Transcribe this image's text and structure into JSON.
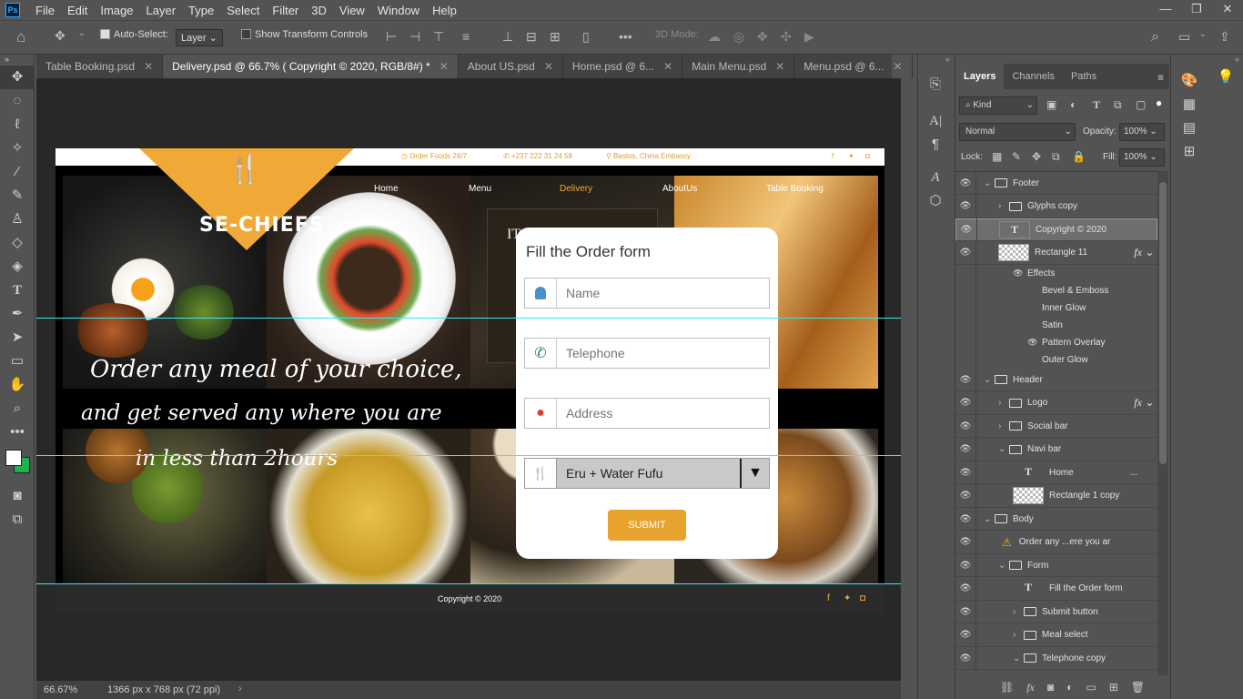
{
  "menu": [
    "File",
    "Edit",
    "Image",
    "Layer",
    "Type",
    "Select",
    "Filter",
    "3D",
    "View",
    "Window",
    "Help"
  ],
  "options": {
    "auto_select": "Auto-Select:",
    "auto_select_target": "Layer",
    "transform_controls": "Show Transform Controls",
    "mode_3d": "3D Mode:"
  },
  "tabs": [
    {
      "label": "Table Booking.psd",
      "active": false
    },
    {
      "label": "Delivery.psd @ 66.7% ( Copyright © 2020, RGB/8#) *",
      "active": true
    },
    {
      "label": "About US.psd",
      "active": false
    },
    {
      "label": "Home.psd @ 6...",
      "active": false
    },
    {
      "label": "Main Menu.psd",
      "active": false
    },
    {
      "label": "Menu.psd @ 6...",
      "active": false
    }
  ],
  "status": {
    "zoom": "66.67%",
    "doc_size": "1366 px x 768 px (72 ppi)"
  },
  "site": {
    "topbar": {
      "order": "Order Foods 24/7",
      "phone": "+237 222 31 24 58",
      "location": "Bastos, China Embassy"
    },
    "logo": "SE-CHIEFS",
    "nav": [
      "Home",
      "Menu",
      "Delivery",
      "AboutUs",
      "Table Booking"
    ],
    "active_nav": "Delivery",
    "tagline": [
      "Order any meal of your choice,",
      "and get served any where you are",
      "in less than 2hours"
    ],
    "footer": "Copyright © 2020",
    "partial_text": "IT"
  },
  "form": {
    "title": "Fill the Order form",
    "name_placeholder": "Name",
    "phone_placeholder": "Telephone",
    "address_placeholder": "Address",
    "meal_value": "Eru + Water Fufu",
    "submit": "SUBMIT"
  },
  "panel": {
    "tabs": [
      "Layers",
      "Channels",
      "Paths"
    ],
    "filter_kind": "Kind",
    "blend_mode": "Normal",
    "opacity_label": "Opacity:",
    "opacity": "100%",
    "lock_label": "Lock:",
    "fill_label": "Fill:",
    "fill": "100%"
  },
  "layers": [
    {
      "name": "Footer",
      "type": "group",
      "indent": 0,
      "open": true
    },
    {
      "name": "Glyphs copy",
      "type": "group",
      "indent": 1,
      "open": false
    },
    {
      "name": "Copyright © 2020",
      "type": "text",
      "indent": 1,
      "selected": true
    },
    {
      "name": "Rectangle 11",
      "type": "shape",
      "indent": 1,
      "fx": true
    },
    {
      "name": "Effects",
      "type": "effect",
      "indent": 2,
      "eye": true
    },
    {
      "name": "Bevel & Emboss",
      "type": "effect",
      "indent": 3,
      "eye": false
    },
    {
      "name": "Inner Glow",
      "type": "effect",
      "indent": 3,
      "eye": false
    },
    {
      "name": "Satin",
      "type": "effect",
      "indent": 3,
      "eye": false
    },
    {
      "name": "Pattern Overlay",
      "type": "effect",
      "indent": 3,
      "eye": true
    },
    {
      "name": "Outer Glow",
      "type": "effect",
      "indent": 3,
      "eye": false
    },
    {
      "name": "Header",
      "type": "group",
      "indent": 0,
      "open": true
    },
    {
      "name": "Logo",
      "type": "group",
      "indent": 1,
      "open": false,
      "fx": true
    },
    {
      "name": "Social bar",
      "type": "group",
      "indent": 1,
      "open": false
    },
    {
      "name": "Navi bar",
      "type": "group",
      "indent": 1,
      "open": true
    },
    {
      "name": "Home",
      "type": "text",
      "indent": 2,
      "more": "..."
    },
    {
      "name": "Rectangle 1 copy",
      "type": "shape",
      "indent": 2
    },
    {
      "name": "Body",
      "type": "group",
      "indent": 0,
      "open": true
    },
    {
      "name": "Order any ...ere you ar",
      "type": "warn",
      "indent": 1
    },
    {
      "name": "Form",
      "type": "group",
      "indent": 1,
      "open": true
    },
    {
      "name": "Fill the Order form",
      "type": "text",
      "indent": 2
    },
    {
      "name": "Submit button",
      "type": "group",
      "indent": 2,
      "open": false
    },
    {
      "name": "Meal select",
      "type": "group",
      "indent": 2,
      "open": false
    },
    {
      "name": "Telephone copy",
      "type": "group",
      "indent": 2,
      "open": true
    }
  ],
  "colors": {
    "accent": "#f0a936",
    "guide": "#39e8ef",
    "panel_bg": "#535353",
    "selected_layer": "#6e6e6e"
  }
}
